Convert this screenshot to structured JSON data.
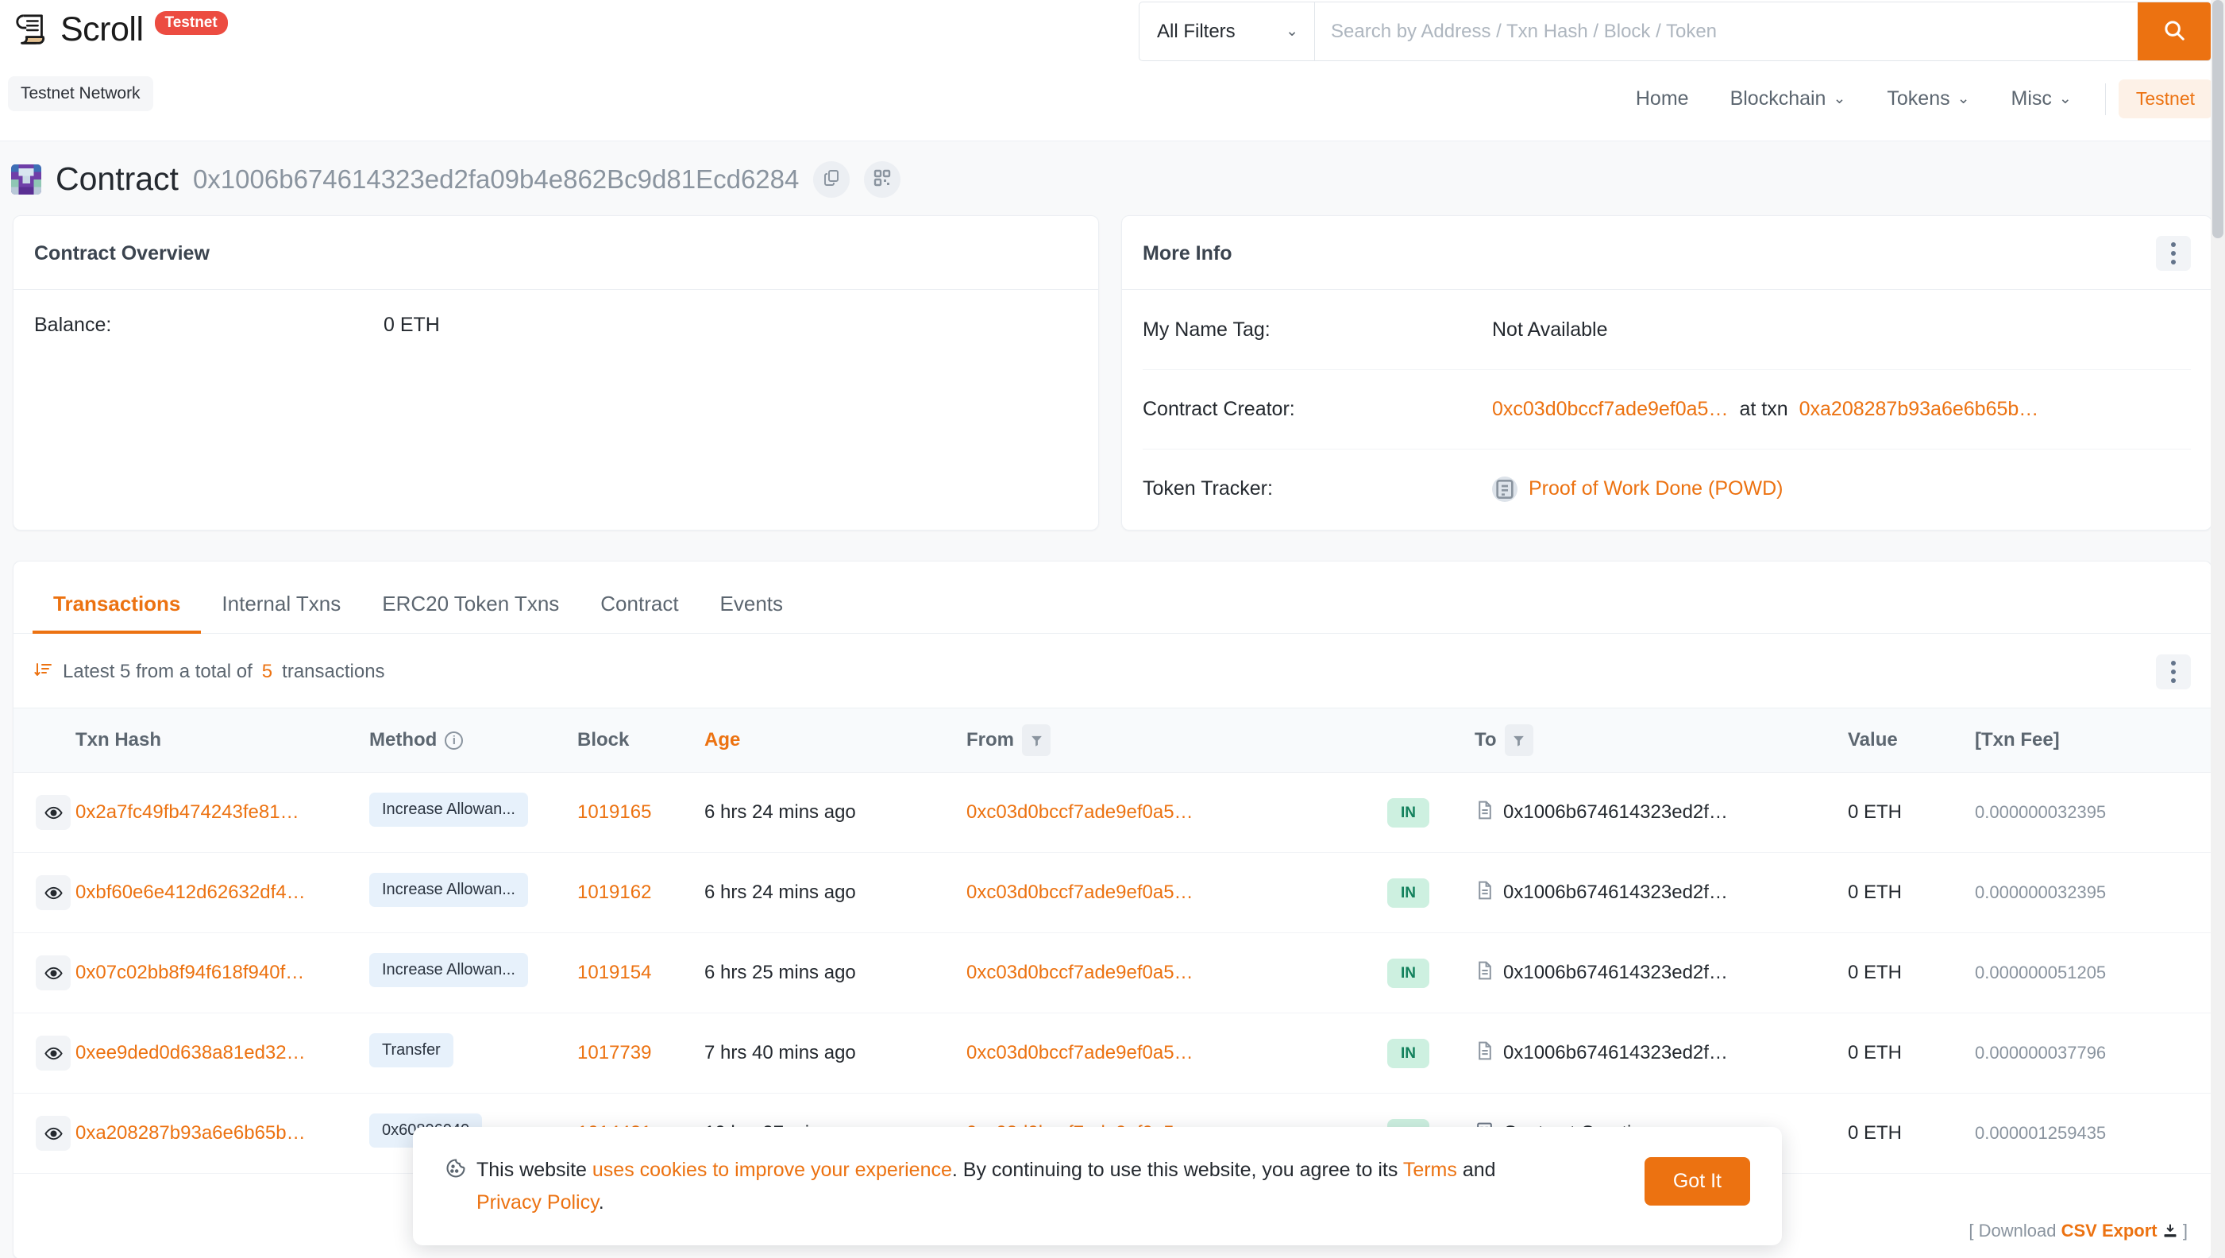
{
  "brand": {
    "name": "Scroll",
    "badge": "Testnet",
    "network_chip": "Testnet Network",
    "logo_icon": "scroll-logo-icon"
  },
  "search": {
    "filter_label": "All Filters",
    "placeholder": "Search by Address / Txn Hash / Block / Token",
    "value": "",
    "button_icon": "search-icon"
  },
  "nav": {
    "items": [
      {
        "label": "Home",
        "caret": false
      },
      {
        "label": "Blockchain",
        "caret": true
      },
      {
        "label": "Tokens",
        "caret": true
      },
      {
        "label": "Misc",
        "caret": true
      }
    ],
    "network_button": "Testnet",
    "caret_glyph": "⌄"
  },
  "page": {
    "title": "Contract",
    "address": "0x1006b674614323ed2fa09b4e862Bc9d81Ecd6284",
    "copy_icon": "copy-icon",
    "qr_icon": "qr-code-icon"
  },
  "overview": {
    "heading": "Contract Overview",
    "rows": [
      {
        "key": "Balance:",
        "value": "0 ETH"
      }
    ]
  },
  "more_info": {
    "heading": "More Info",
    "menu_icon": "kebab-menu-icon",
    "name_tag": {
      "key": "My Name Tag:",
      "value": "Not Available"
    },
    "creator": {
      "key": "Contract Creator:",
      "address": "0xc03d0bccf7ade9ef0a5…",
      "separator": "at txn",
      "txn": "0xa208287b93a6e6b65b…"
    },
    "token_tracker": {
      "key": "Token Tracker:",
      "value": "Proof of Work Done (POWD)",
      "icon": "token-icon"
    }
  },
  "tabs": {
    "items": [
      {
        "label": "Transactions",
        "active": true
      },
      {
        "label": "Internal Txns",
        "active": false
      },
      {
        "label": "ERC20 Token Txns",
        "active": false
      },
      {
        "label": "Contract",
        "active": false
      },
      {
        "label": "Events",
        "active": false
      }
    ]
  },
  "subbar": {
    "sort_icon": "sort-descending-icon",
    "text_before": "Latest 5 from a total of",
    "count": "5",
    "text_after": "transactions",
    "menu_icon": "kebab-menu-icon"
  },
  "table": {
    "columns": {
      "eye": "",
      "txn_hash": "Txn Hash",
      "method": "Method",
      "method_info_icon": "info-icon",
      "block": "Block",
      "age": "Age",
      "from": "From",
      "from_filter_icon": "filter-icon",
      "direction": "",
      "to": "To",
      "to_filter_icon": "filter-icon",
      "value": "Value",
      "fee": "[Txn Fee]"
    },
    "rows": [
      {
        "eye_icon": "eye-icon",
        "txn_hash": "0x2a7fc49fb474243fe81…",
        "method": "Increase Allowan...",
        "block": "1019165",
        "age": "6 hrs 24 mins ago",
        "from": "0xc03d0bccf7ade9ef0a5…",
        "direction": "IN",
        "to": "0x1006b674614323ed2f…",
        "to_icon": "contract-doc-icon",
        "value": "0 ETH",
        "fee": "0.000000032395"
      },
      {
        "eye_icon": "eye-icon",
        "txn_hash": "0xbf60e6e412d62632df4…",
        "method": "Increase Allowan...",
        "block": "1019162",
        "age": "6 hrs 24 mins ago",
        "from": "0xc03d0bccf7ade9ef0a5…",
        "direction": "IN",
        "to": "0x1006b674614323ed2f…",
        "to_icon": "contract-doc-icon",
        "value": "0 ETH",
        "fee": "0.000000032395"
      },
      {
        "eye_icon": "eye-icon",
        "txn_hash": "0x07c02bb8f94f618f940f…",
        "method": "Increase Allowan...",
        "block": "1019154",
        "age": "6 hrs 25 mins ago",
        "from": "0xc03d0bccf7ade9ef0a5…",
        "direction": "IN",
        "to": "0x1006b674614323ed2f…",
        "to_icon": "contract-doc-icon",
        "value": "0 ETH",
        "fee": "0.000000051205"
      },
      {
        "eye_icon": "eye-icon",
        "txn_hash": "0xee9ded0d638a81ed32…",
        "method": "Transfer",
        "block": "1017739",
        "age": "7 hrs 40 mins ago",
        "from": "0xc03d0bccf7ade9ef0a5…",
        "direction": "IN",
        "to": "0x1006b674614323ed2f…",
        "to_icon": "contract-doc-icon",
        "value": "0 ETH",
        "fee": "0.000000037796"
      },
      {
        "eye_icon": "eye-icon",
        "txn_hash": "0xa208287b93a6e6b65b…",
        "method": "0x60806040",
        "block": "1014421",
        "age": "10 hrs 37 mins ago",
        "from": "0xc03d0bccf7ade9ef0a5",
        "direction": "IN",
        "to": "Contract Creation",
        "to_icon": "contract-creation-icon",
        "value": "0 ETH",
        "fee": "0.000001259435"
      }
    ]
  },
  "csv_export": {
    "bracket_open": "[",
    "download_label": "Download",
    "link_label": "CSV Export",
    "icon": "download-icon",
    "bracket_close": "]"
  },
  "cookie": {
    "icon": "cookie-icon",
    "part1": "This website ",
    "link1": "uses cookies to improve your experience",
    "part2": ". By continuing to use this website, you agree to its ",
    "link2": "Terms",
    "part3": " and ",
    "link3": "Privacy Policy",
    "part4": ".",
    "button": "Got It"
  },
  "colors": {
    "accent": "#ec7211",
    "badge_red": "#ec4c41",
    "in_green_bg": "#cdf0e0",
    "in_green_text": "#12805c",
    "method_blue_bg": "#e7f1fb",
    "muted": "#8a949f",
    "page_bg": "#f8f9fa"
  }
}
